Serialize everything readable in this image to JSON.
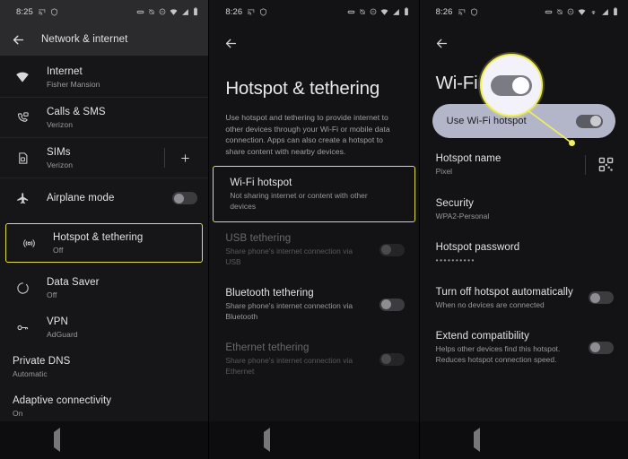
{
  "panels": [
    {
      "id": "network-internet",
      "status": {
        "time": "8:25",
        "icons": [
          "cast-icon",
          "alarm-off-icon",
          "dnd-icon",
          "wifi-icon",
          "signal-icon",
          "battery-icon"
        ]
      },
      "appbar": {
        "title": "Network & internet",
        "back_icon": "back-arrow-icon"
      },
      "items": [
        {
          "icon": "wifi-icon",
          "title": "Internet",
          "subtitle": "Fisher Mansion",
          "control": "none"
        },
        {
          "icon": "calls-sms-icon",
          "title": "Calls & SMS",
          "subtitle": "Verizon",
          "control": "none"
        },
        {
          "icon": "sim-icon",
          "title": "SIMs",
          "subtitle": "Verizon",
          "control": "add"
        },
        {
          "icon": "airplane-icon",
          "title": "Airplane mode",
          "subtitle": "",
          "control": "toggle",
          "toggle_on": false
        },
        {
          "icon": "hotspot-icon",
          "title": "Hotspot & tethering",
          "subtitle": "Off",
          "control": "none",
          "highlighted": true
        },
        {
          "icon": "data-saver-icon",
          "title": "Data Saver",
          "subtitle": "Off",
          "control": "none"
        },
        {
          "icon": "vpn-key-icon",
          "title": "VPN",
          "subtitle": "AdGuard",
          "control": "none"
        },
        {
          "icon": "none",
          "title": "Private DNS",
          "subtitle": "Automatic",
          "control": "none"
        },
        {
          "icon": "none",
          "title": "Adaptive connectivity",
          "subtitle": "On",
          "control": "none"
        }
      ]
    },
    {
      "id": "hotspot-tethering",
      "status": {
        "time": "8:26",
        "icons": [
          "cast-icon",
          "alarm-off-icon",
          "dnd-icon",
          "wifi-icon",
          "signal-icon",
          "battery-icon"
        ]
      },
      "back_icon": "back-arrow-icon",
      "title": "Hotspot & tethering",
      "blurb": "Use hotspot and tethering to provide internet to other devices through your Wi-Fi or mobile data connection. Apps can also create a hotspot to share content with nearby devices.",
      "items": [
        {
          "title": "Wi-Fi hotspot",
          "subtitle": "Not sharing internet or content with other devices",
          "control": "none",
          "highlighted": true,
          "disabled": false
        },
        {
          "title": "USB tethering",
          "subtitle": "Share phone's internet connection via USB",
          "control": "toggle",
          "toggle_on": false,
          "disabled": true
        },
        {
          "title": "Bluetooth tethering",
          "subtitle": "Share phone's internet connection via Bluetooth",
          "control": "toggle",
          "toggle_on": false,
          "disabled": false
        },
        {
          "title": "Ethernet tethering",
          "subtitle": "Share phone's internet connection via Ethernet",
          "control": "toggle",
          "toggle_on": false,
          "disabled": true
        }
      ]
    },
    {
      "id": "wifi-hotspot",
      "status": {
        "time": "8:26",
        "icons": [
          "cast-icon",
          "alarm-off-icon",
          "dnd-icon",
          "wifi-icon",
          "hotspot-icon",
          "signal-icon",
          "battery-icon"
        ]
      },
      "back_icon": "back-arrow-icon",
      "title": "Wi-Fi hotspot",
      "card": {
        "label": "Use Wi-Fi hotspot",
        "toggle_on": true
      },
      "callout": {
        "type": "magnifier",
        "shows": "use-wifi-hotspot-toggle",
        "border_color": "#f2ef5d",
        "fill_color": "#f3f2fb"
      },
      "items": [
        {
          "title": "Hotspot name",
          "subtitle": "Pixel",
          "control": "qr"
        },
        {
          "title": "Security",
          "subtitle": "WPA2-Personal",
          "control": "none"
        },
        {
          "title": "Hotspot password",
          "subtitle": "••••••••••",
          "control": "none"
        },
        {
          "title": "Turn off hotspot automatically",
          "subtitle": "When no devices are connected",
          "control": "toggle",
          "toggle_on": false
        },
        {
          "title": "Extend compatibility",
          "subtitle": "Helps other devices find this hotspot. Reduces hotspot connection speed.",
          "control": "toggle",
          "toggle_on": false
        }
      ]
    }
  ],
  "navbar": {
    "back": "back-nav-icon",
    "home": "home-nav-icon",
    "recents": "recents-nav-icon"
  },
  "colors": {
    "highlight": "#e3e14a",
    "callout": "#f2ef5d",
    "card": "#b3b6c9",
    "bg": "#131315",
    "appbar": "#2b2b2d"
  }
}
